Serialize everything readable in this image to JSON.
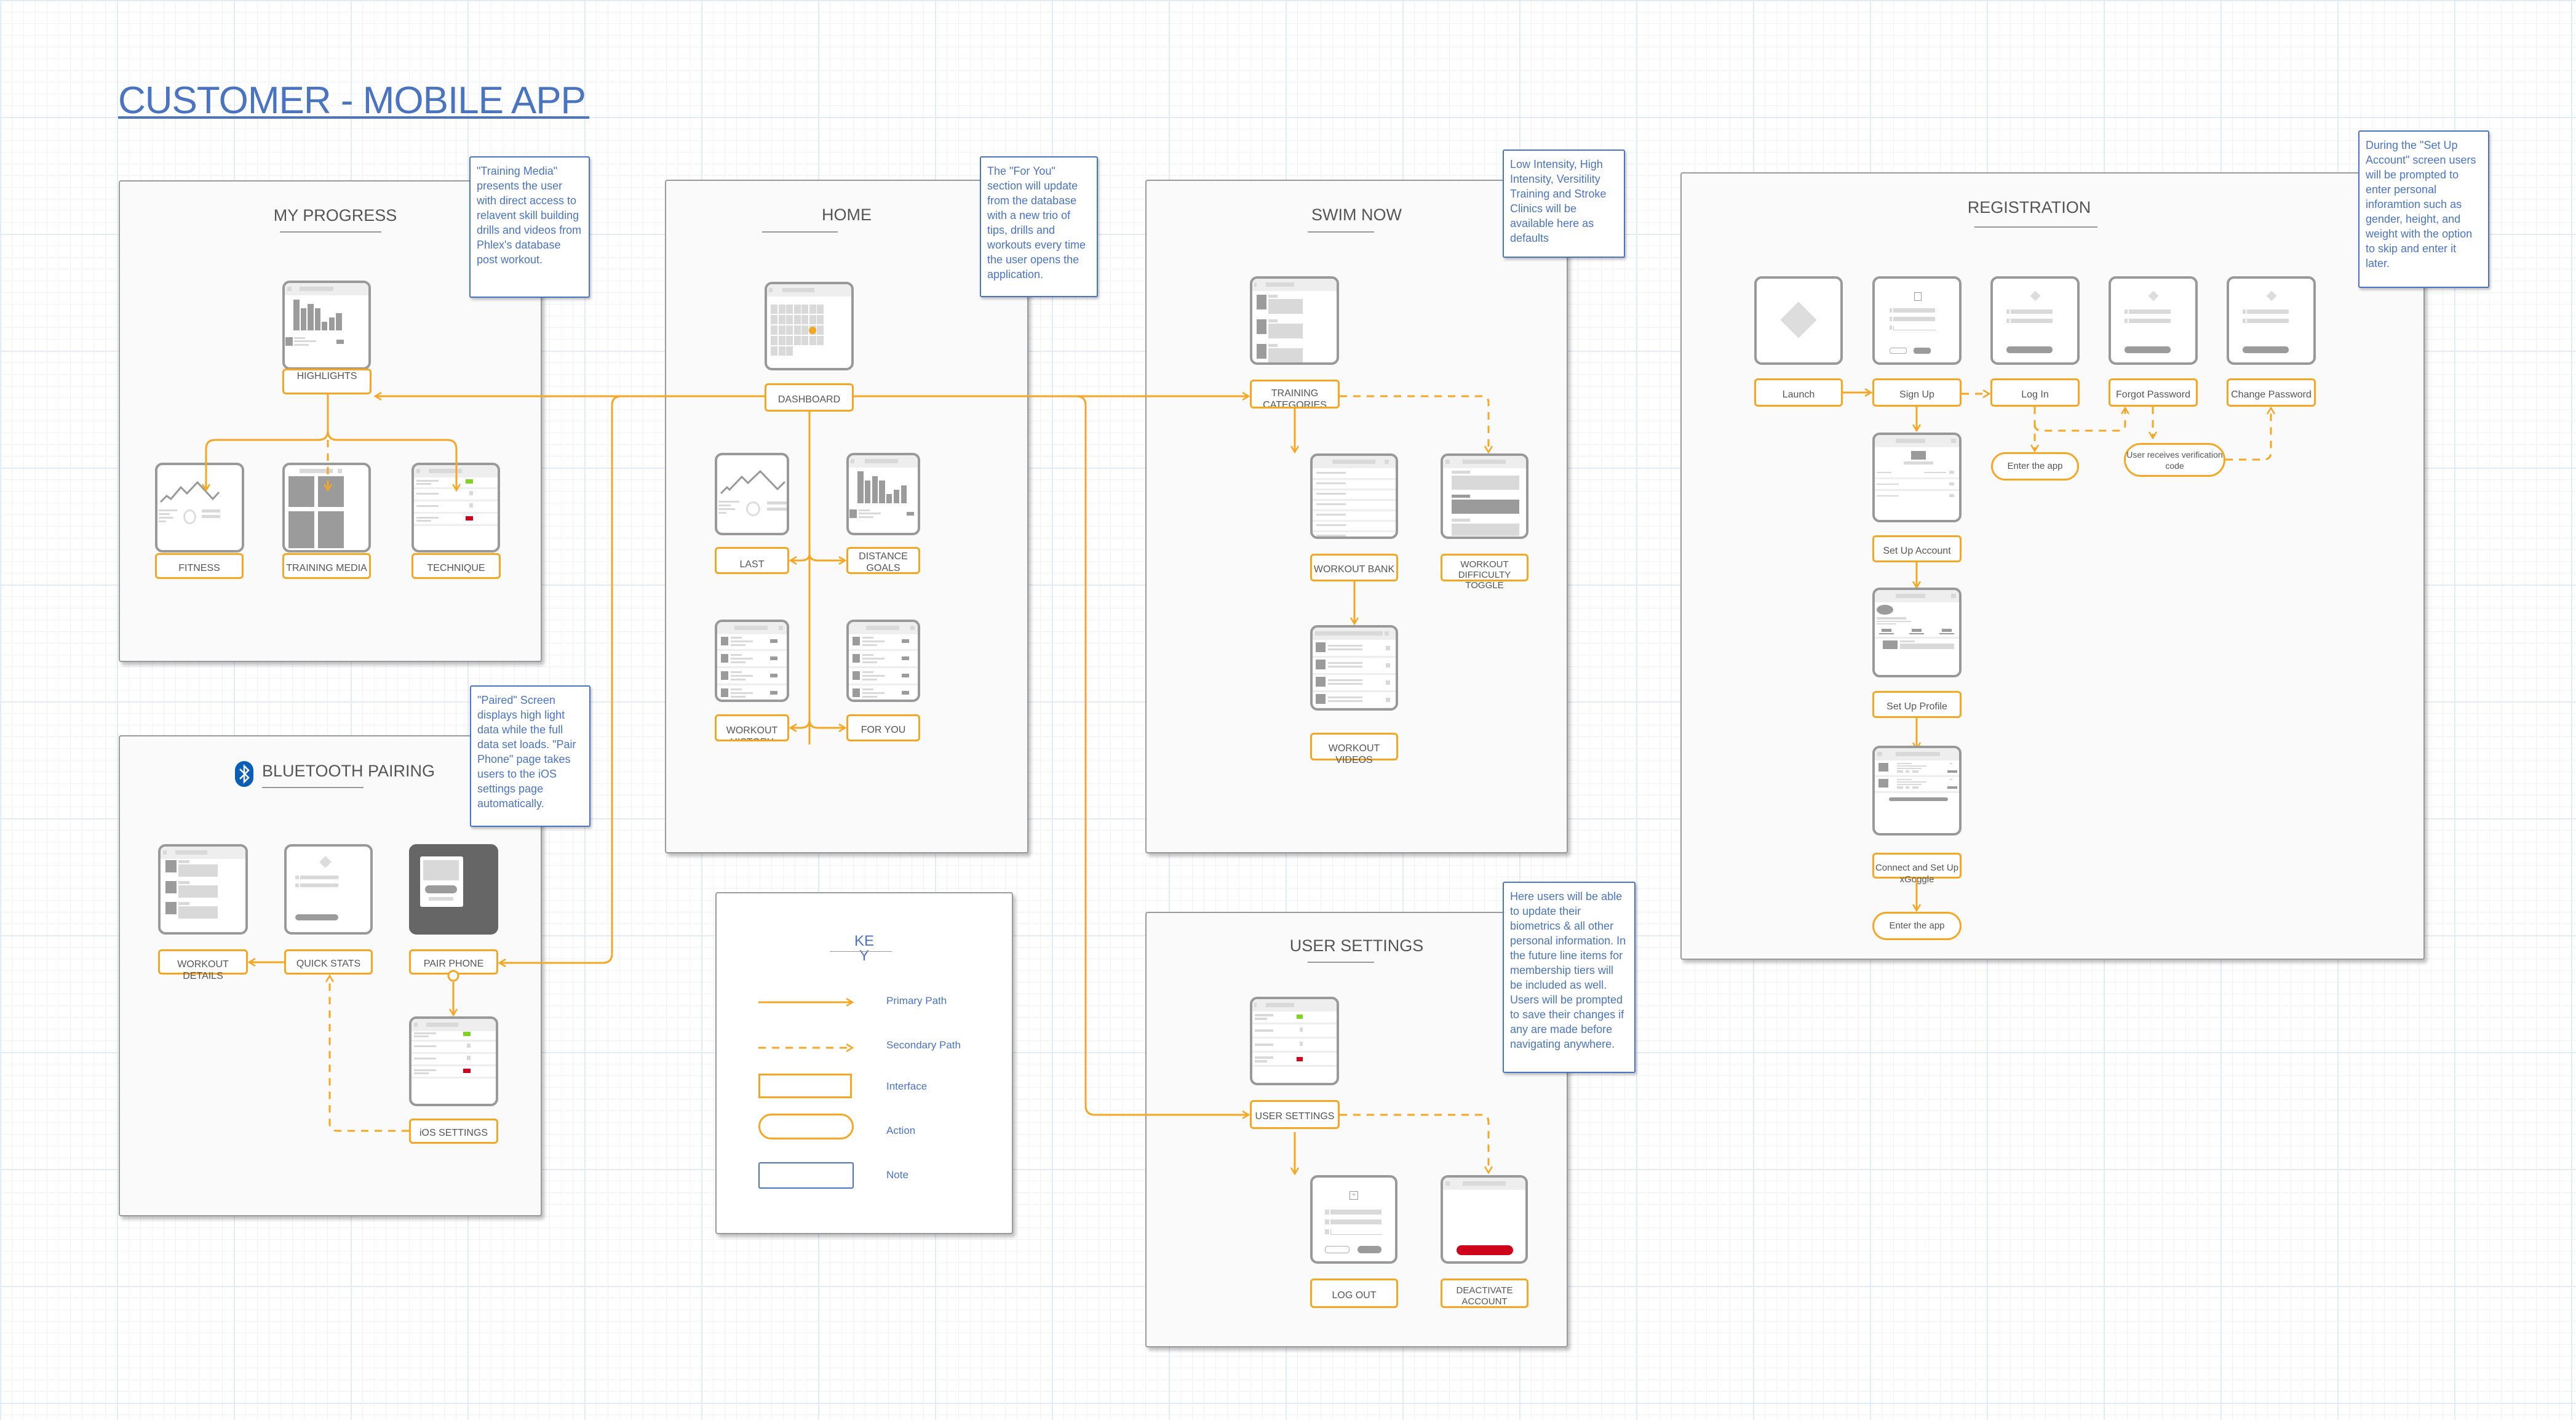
{
  "title": "CUSTOMER - MOBILE APP",
  "colors": {
    "accent_orange": "#f5a623",
    "note_blue": "#4a74c0",
    "status_green": "#7ed321",
    "status_red": "#d0021b",
    "bluetooth_blue": "#0a5fb4"
  },
  "sections": {
    "my_progress": {
      "title": "MY PROGRESS",
      "interfaces": [
        "HIGHLIGHTS",
        "FITNESS",
        "TRAINING MEDIA",
        "TECHNIQUE"
      ],
      "note": "\"Training Media\" presents the user with direct access to relavent skill building drills and videos from Phlex's database post workout."
    },
    "home": {
      "title": "HOME",
      "interfaces": [
        "DASHBOARD",
        "LAST WORKOUT",
        "DISTANCE GOALS",
        "WORKOUT HISTORY",
        "FOR YOU"
      ],
      "note": "The \"For You\" section will update from the database with a new trio of tips, drills and workouts every time the user opens the application."
    },
    "swim_now": {
      "title": "SWIM NOW",
      "interfaces": [
        "TRAINING CATEGORIES",
        "WORKOUT BANK",
        "WORKOUT DIFFICULTY TOGGLE",
        "WORKOUT VIDEOS"
      ],
      "note": "Low Intensity, High Intensity, Versitility Training and Stroke Clinics will be available here as defaults"
    },
    "registration": {
      "title": "REGISTRATION",
      "interfaces": [
        "Launch",
        "Sign Up",
        "Log In",
        "Forgot Password",
        "Change Password",
        "Set Up Account",
        "Set Up Profile",
        "Connect and Set Up xGoggle"
      ],
      "actions": [
        "Enter the app",
        "User receives verification code",
        "Enter the app"
      ],
      "note": "During the \"Set Up Account\" screen users will be prompted to enter personal inforamtion such as gender, height, and weight with the option to skip and enter it later."
    },
    "bluetooth": {
      "title": "BLUETOOTH PAIRING",
      "interfaces": [
        "WORKOUT DETAILS",
        "QUICK STATS",
        "PAIR PHONE",
        "iOS SETTINGS"
      ],
      "note": "\"Paired\" Screen displays high light data while the full data set loads. \"Pair Phone\" page takes users to the iOS settings page automatically."
    },
    "user_settings": {
      "title": "USER SETTINGS",
      "interfaces": [
        "USER SETTINGS",
        "LOG OUT",
        "DEACTIVATE ACCOUNT"
      ],
      "note": "Here users will be able to update their biometrics & all other personal information. In the future line items for membership tiers will be included as well.\nUsers will be prompted to save their changes if any are made before navigating anywhere."
    }
  },
  "key": {
    "title": "KEY",
    "items": [
      {
        "symbol": "solid-arrow",
        "label": "Primary Path"
      },
      {
        "symbol": "dashed-arrow",
        "label": "Secondary Path"
      },
      {
        "symbol": "orange-rect",
        "label": "Interface"
      },
      {
        "symbol": "orange-pill",
        "label": "Action"
      },
      {
        "symbol": "blue-rect",
        "label": "Note"
      }
    ]
  }
}
